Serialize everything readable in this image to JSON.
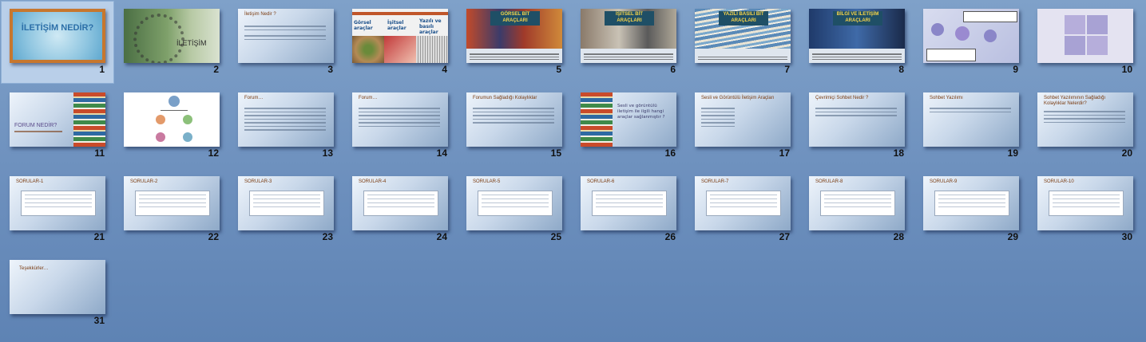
{
  "slides": [
    {
      "number": "1",
      "type": "title",
      "title": "İLETİŞİM NEDİR?",
      "selected": true
    },
    {
      "number": "2",
      "type": "image",
      "title": "İLETİŞİM"
    },
    {
      "number": "3",
      "type": "text",
      "title": "İletişim Nedir ?"
    },
    {
      "number": "4",
      "type": "image3",
      "labels": [
        "Görsel araçlar",
        "İşitsel araçlar",
        "Yazılı ve basılı araçlar"
      ]
    },
    {
      "number": "5",
      "type": "banner",
      "title": "GÖRSEL BİT ARAÇLARI"
    },
    {
      "number": "6",
      "type": "banner",
      "title": "İŞİTSEL BİT ARAÇLARI"
    },
    {
      "number": "7",
      "type": "banner",
      "title": "YAZILI BASILI BİT ARAÇLARI"
    },
    {
      "number": "8",
      "type": "banner",
      "title": "BİLGİ VE İLETİŞİM ARAÇLARI"
    },
    {
      "number": "9",
      "type": "diagram"
    },
    {
      "number": "10",
      "type": "diagram2"
    },
    {
      "number": "11",
      "type": "books-left",
      "title": "FORUM NEDİR?"
    },
    {
      "number": "12",
      "type": "orgchart"
    },
    {
      "number": "13",
      "type": "text",
      "title": "Forum…"
    },
    {
      "number": "14",
      "type": "text",
      "title": "Forum…"
    },
    {
      "number": "15",
      "type": "text",
      "title": "Forumun Sağladığı Kolaylıklar"
    },
    {
      "number": "16",
      "type": "books-right",
      "title": "Sesli ve görüntülü iletişim ile ilgili hangi araçlar sağlanmıştır ?"
    },
    {
      "number": "17",
      "type": "text",
      "title": "Sesli ve Görüntülü İletişim Araçları"
    },
    {
      "number": "18",
      "type": "text",
      "title": "Çevrimiçi Sohbet Nedir ?"
    },
    {
      "number": "19",
      "type": "text",
      "title": "Sohbet Yazılımı"
    },
    {
      "number": "20",
      "type": "text",
      "title": "Sohbet Yazılımının Sağladığı Kolaylıklar Nelerdir?"
    },
    {
      "number": "21",
      "type": "quiz",
      "title": "SORULAR-1"
    },
    {
      "number": "22",
      "type": "quiz",
      "title": "SORULAR-2"
    },
    {
      "number": "23",
      "type": "quiz",
      "title": "SORULAR-3"
    },
    {
      "number": "24",
      "type": "quiz",
      "title": "SORULAR-4"
    },
    {
      "number": "25",
      "type": "quiz",
      "title": "SORULAR-5"
    },
    {
      "number": "26",
      "type": "quiz",
      "title": "SORULAR-6"
    },
    {
      "number": "27",
      "type": "quiz",
      "title": "SORULAR-7"
    },
    {
      "number": "28",
      "type": "quiz",
      "title": "SORULAR-8"
    },
    {
      "number": "29",
      "type": "quiz",
      "title": "SORULAR-9"
    },
    {
      "number": "30",
      "type": "quiz",
      "title": "SORULAR-10"
    },
    {
      "number": "31",
      "type": "text",
      "title": "Teşekkürler…"
    }
  ],
  "colors": {
    "accent": "#7a3b10",
    "selection": "#b9cfe9",
    "banner": "#1f4f66",
    "bannerText": "#f6d34a"
  }
}
